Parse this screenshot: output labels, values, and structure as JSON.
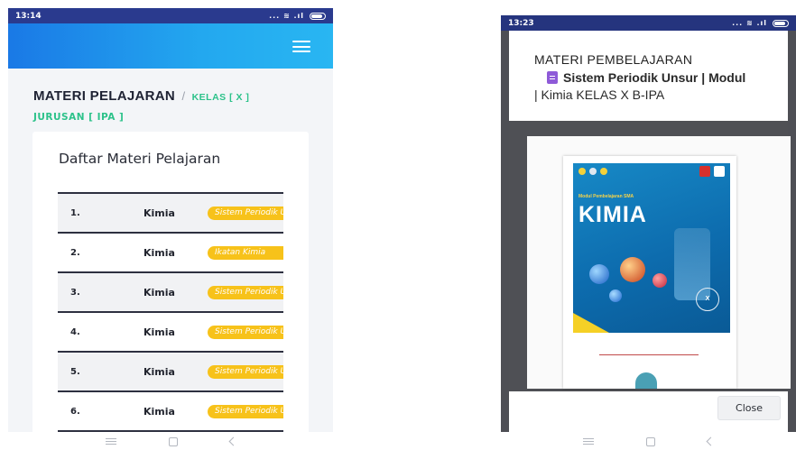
{
  "phone1": {
    "status": {
      "time": "13:14",
      "signal_text": "... ≋ .ıl"
    },
    "heading": {
      "title": "MATERI PELAJARAN",
      "slash": "/",
      "kelas": "KELAS [ X ]",
      "jurusan": "JURUSAN [ IPA ]"
    },
    "card": {
      "title": "Daftar Materi Pelajaran",
      "rows": [
        {
          "num": "1.",
          "subject": "Kimia",
          "badge": "Sistem Periodik Unsur"
        },
        {
          "num": "2.",
          "subject": "Kimia",
          "badge": "Ikatan Kimia"
        },
        {
          "num": "3.",
          "subject": "Kimia",
          "badge": "Sistem Periodik Unsur"
        },
        {
          "num": "4.",
          "subject": "Kimia",
          "badge": "Sistem Periodik Unsur"
        },
        {
          "num": "5.",
          "subject": "Kimia",
          "badge": "Sistem Periodik Unsur"
        },
        {
          "num": "6.",
          "subject": "Kimia",
          "badge": "Sistem Periodik Unsur"
        }
      ]
    },
    "colors": {
      "appbar_start": "#1a79e6",
      "appbar_end": "#29b6f2",
      "accent": "#2cc28a",
      "badge": "#f7c21a"
    }
  },
  "phone2": {
    "status": {
      "time": "13:23",
      "signal_text": "... ≋ .ıl"
    },
    "modal": {
      "title": "MATERI PEMBELAJARAN",
      "doc_line1": "Sistem Periodik Unsur | Modul",
      "doc_line2": "| Kimia KELAS X B-IPA",
      "doc_icon": "document-icon",
      "close_label": "Close"
    },
    "cover": {
      "subtitle": "Modul Pembelajaran SMA",
      "title": "KIMIA",
      "kelas_label": "KELAS",
      "kelas_value": "X"
    }
  }
}
